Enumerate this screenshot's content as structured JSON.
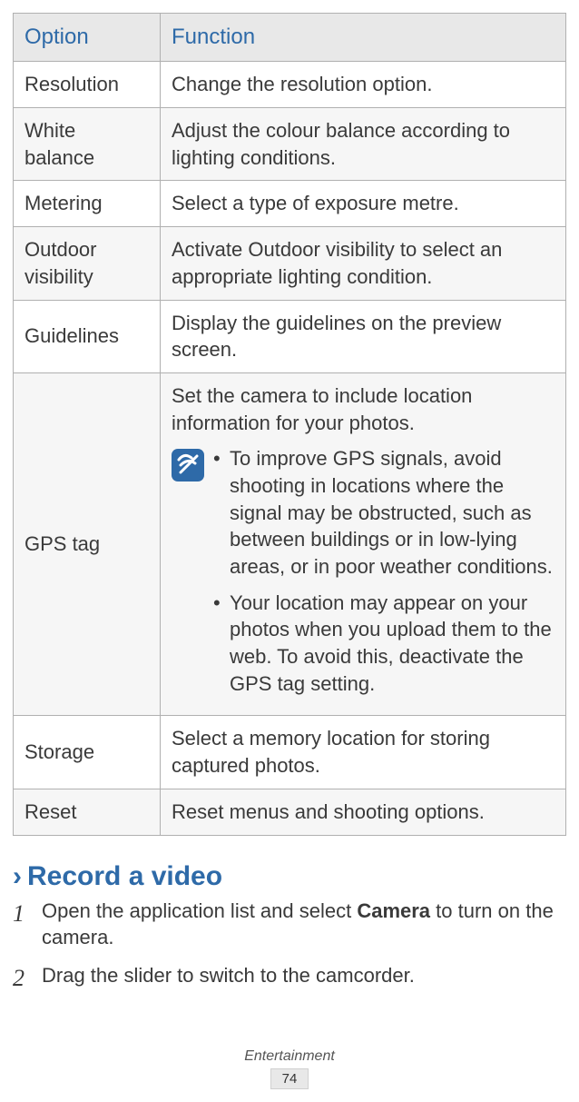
{
  "table": {
    "header": {
      "option": "Option",
      "function": "Function"
    },
    "rows": [
      {
        "option": "Resolution",
        "function": "Change the resolution option."
      },
      {
        "option": "White balance",
        "function": "Adjust the colour balance according to lighting conditions."
      },
      {
        "option": "Metering",
        "function": "Select a type of exposure metre."
      },
      {
        "option": "Outdoor visibility",
        "function": "Activate Outdoor visibility to select an appropriate lighting condition."
      },
      {
        "option": "Guidelines",
        "function": "Display the guidelines on the preview screen."
      }
    ],
    "gps": {
      "option": "GPS tag",
      "intro": "Set the camera to include location information for your photos.",
      "bullets": [
        "To improve GPS signals, avoid shooting in locations where the signal may be obstructed, such as between buildings or in low-lying areas, or in poor weather conditions.",
        "Your location may appear on your photos when you upload them to the web. To avoid this, deactivate the GPS tag setting."
      ]
    },
    "tail": [
      {
        "option": "Storage",
        "function": "Select a memory location for storing captured photos."
      },
      {
        "option": "Reset",
        "function": "Reset menus and shooting options."
      }
    ]
  },
  "section": {
    "chevron": "›",
    "title": "Record a video",
    "steps": {
      "s1": {
        "num": "1",
        "pre": "Open the application list and select ",
        "bold": "Camera",
        "post": " to turn on the camera."
      },
      "s2": {
        "num": "2",
        "text": "Drag the slider to switch to the camcorder."
      }
    }
  },
  "footer": {
    "category": "Entertainment",
    "page": "74"
  }
}
